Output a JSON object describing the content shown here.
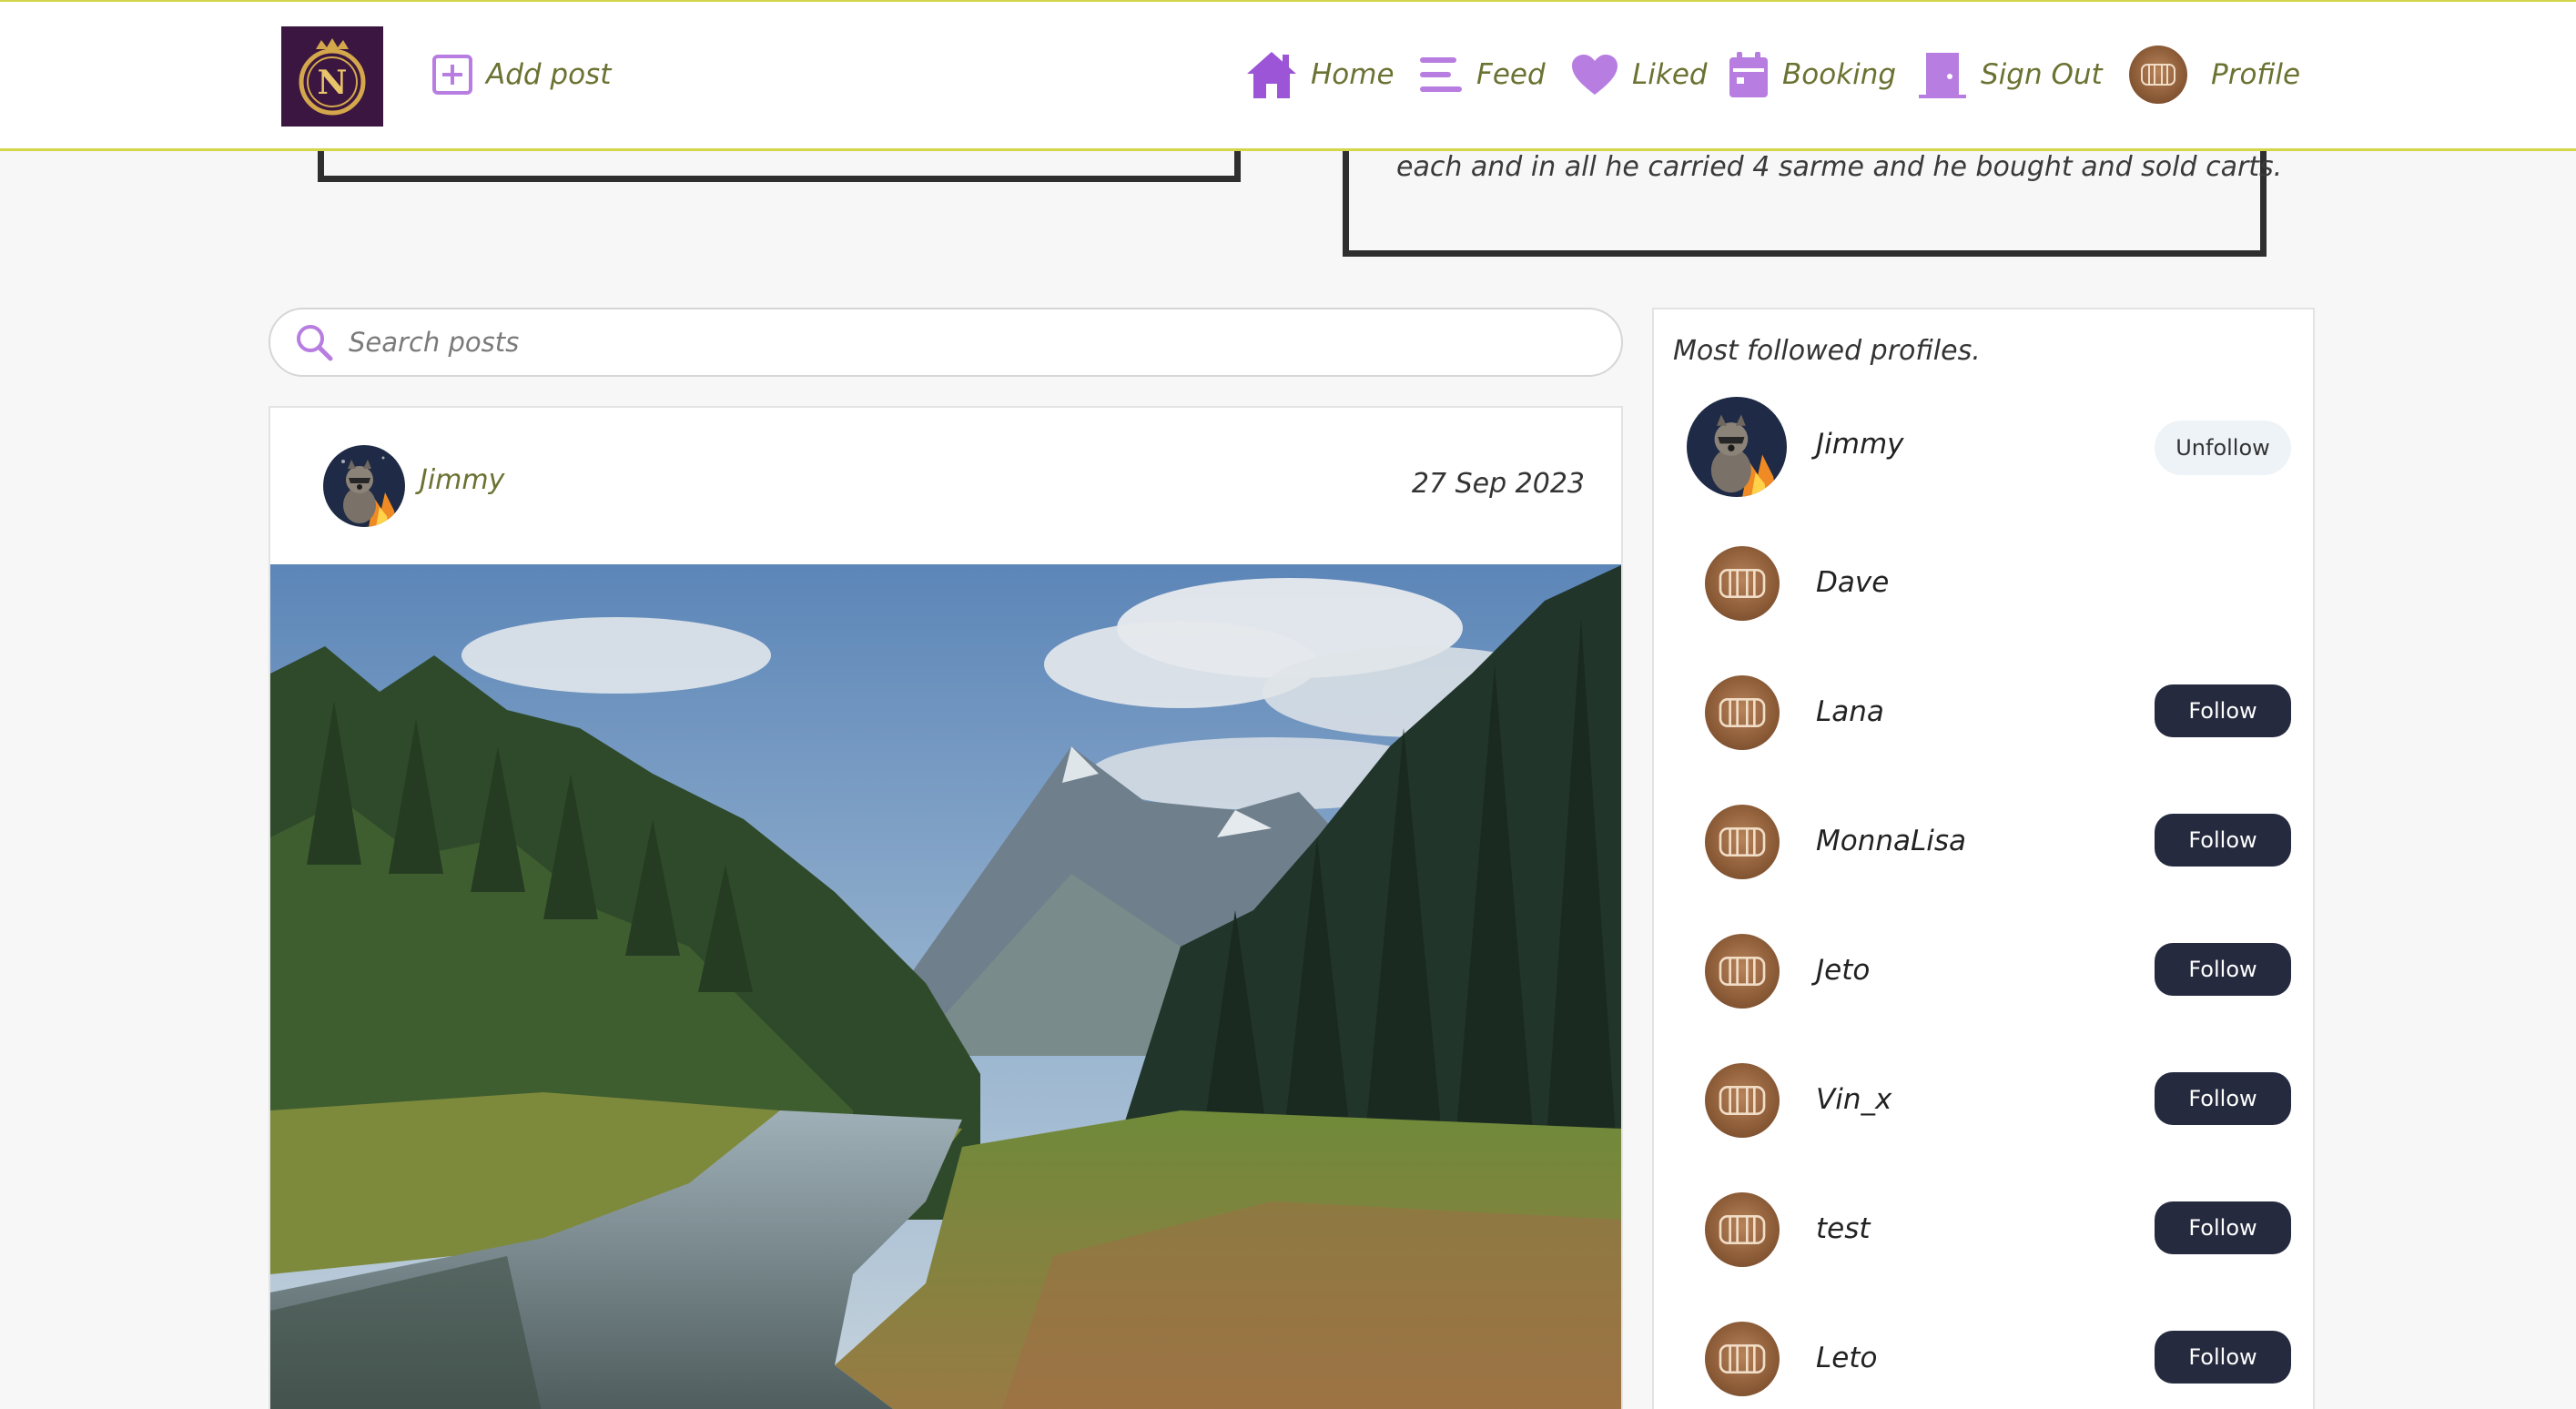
{
  "nav": {
    "logo_letter": "N",
    "add_post": "Add post",
    "items": [
      {
        "label": "Home",
        "icon": "home-icon"
      },
      {
        "label": "Feed",
        "icon": "feed-icon"
      },
      {
        "label": "Liked",
        "icon": "heart-icon"
      },
      {
        "label": "Booking",
        "icon": "calendar-icon"
      },
      {
        "label": "Sign Out",
        "icon": "door-icon"
      },
      {
        "label": "Profile",
        "icon": "barrel-avatar-icon"
      }
    ]
  },
  "feed": {
    "previous_post_snippet": "each and in all he carried 4 sarme and he bought and sold carts."
  },
  "search": {
    "placeholder": "Search posts"
  },
  "post": {
    "author": "Jimmy",
    "date": "27 Sep 2023"
  },
  "sidebar": {
    "title": "Most followed profiles.",
    "profiles": [
      {
        "name": "Jimmy",
        "action": "Unfollow"
      },
      {
        "name": "Dave",
        "action": ""
      },
      {
        "name": "Lana",
        "action": "Follow"
      },
      {
        "name": "MonnaLisa",
        "action": "Follow"
      },
      {
        "name": "Jeto",
        "action": "Follow"
      },
      {
        "name": "Vin_x",
        "action": "Follow"
      },
      {
        "name": "test",
        "action": "Follow"
      },
      {
        "name": "Leto",
        "action": "Follow"
      }
    ]
  },
  "colors": {
    "accent_purple": "#9b55d6",
    "nav_text": "#6b7232",
    "nav_border": "#d4d64a",
    "follow_button": "#252a3e"
  }
}
